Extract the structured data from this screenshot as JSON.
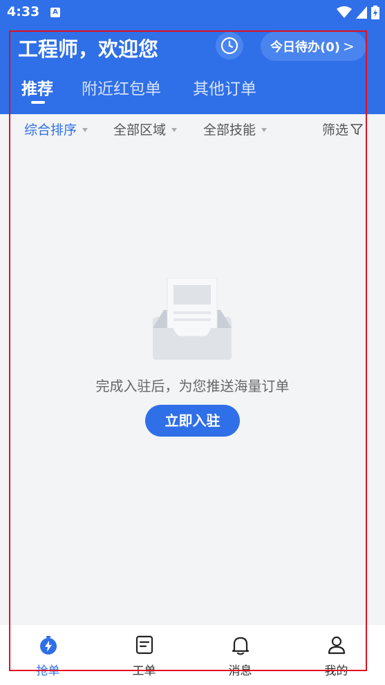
{
  "status_bar": {
    "time": "4:33",
    "notification": "A"
  },
  "header": {
    "title": "工程师，欢迎您",
    "todo_label": "今日待办(0)",
    "todo_arrow": ">"
  },
  "tabs": [
    {
      "label": "推荐",
      "active": true
    },
    {
      "label": "附近红包单",
      "active": false
    },
    {
      "label": "其他订单",
      "active": false
    }
  ],
  "filters": {
    "sort": "综合排序",
    "region": "全部区域",
    "skill": "全部技能",
    "filter": "筛选"
  },
  "empty_state": {
    "message": "完成入驻后，为您推送海量订单",
    "button_label": "立即入驻"
  },
  "bottom_nav": [
    {
      "label": "抢单",
      "icon": "grab-order-icon",
      "active": true
    },
    {
      "label": "工单",
      "icon": "work-order-icon",
      "active": false
    },
    {
      "label": "消息",
      "icon": "bell-icon",
      "active": false
    },
    {
      "label": "我的",
      "icon": "user-icon",
      "active": false
    }
  ],
  "colors": {
    "primary": "#2f6fe8",
    "background": "#f2f4f6",
    "highlight_frame": "#e01020"
  }
}
